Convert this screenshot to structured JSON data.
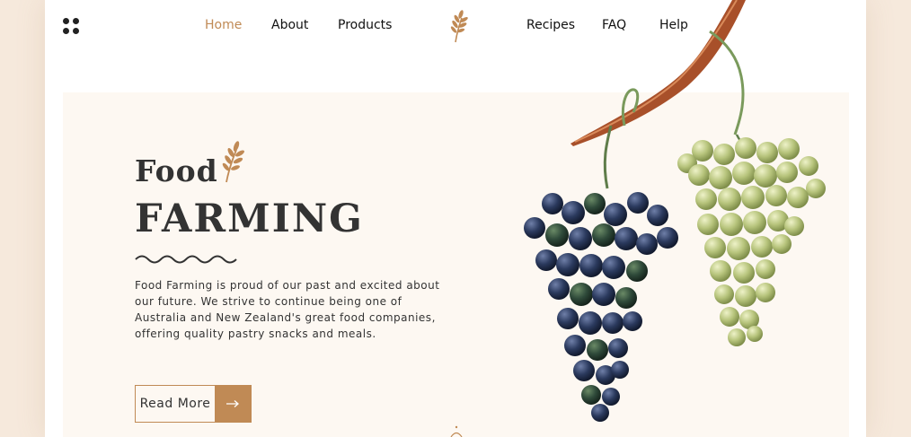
{
  "nav": {
    "left": [
      {
        "label": "Home",
        "active": true
      },
      {
        "label": "About",
        "active": false
      },
      {
        "label": "Products",
        "active": false
      }
    ],
    "right": [
      {
        "label": "Recipes",
        "active": false
      },
      {
        "label": "FAQ",
        "active": false
      },
      {
        "label": "Help",
        "active": false
      }
    ]
  },
  "hero": {
    "title_line1": "Food",
    "title_line2": "FARMING",
    "description": "Food Farming is proud of our past and excited about our future. We strive to continue being one of Australia and New Zealand's great food companies, offering quality pastry snacks and meals.",
    "button_label": "Read More"
  },
  "icons": {
    "menu": "grid-dots-icon",
    "logo": "wheat-icon",
    "arrow": "arrow-right-icon",
    "illustration": "grapes-illustration"
  },
  "colors": {
    "accent": "#c08a55",
    "text": "#333333",
    "hero_bg": "#fdf8f2",
    "outer_bg": "#f6e9dc"
  }
}
